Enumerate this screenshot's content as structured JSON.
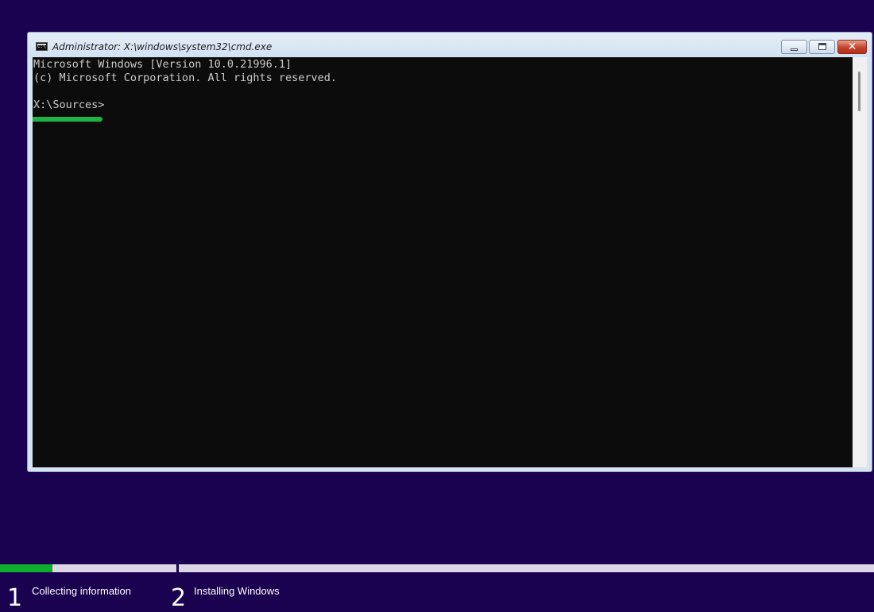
{
  "window": {
    "title": "Administrator: X:\\windows\\system32\\cmd.exe",
    "icon": "console-app-icon"
  },
  "title_buttons": {
    "minimize_icon": "minimize-icon",
    "maximize_icon": "maximize-icon",
    "close_icon": "close-icon",
    "close_glyph": "✕"
  },
  "console": {
    "lines": [
      "Microsoft Windows [Version 10.0.21996.1]",
      "(c) Microsoft Corporation. All rights reserved.",
      "X:\\Sources>"
    ],
    "text_color": "#cccccc",
    "background": "#0c0c0c",
    "highlight_color": "#1fb346"
  },
  "setup": {
    "progress": 0.06,
    "progress_color": "#0fad2e",
    "background": "#1a0250",
    "steps": [
      {
        "number": "1",
        "label": "Collecting information"
      },
      {
        "number": "2",
        "label": "Installing Windows"
      }
    ]
  }
}
